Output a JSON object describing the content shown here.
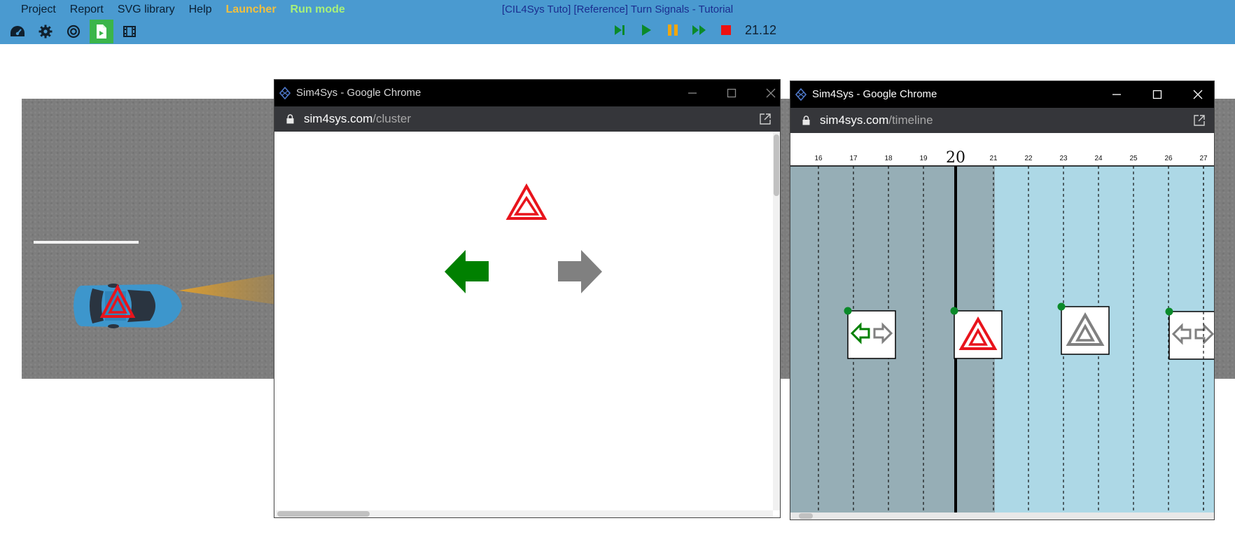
{
  "menu": {
    "items": [
      "Project",
      "Report",
      "SVG library",
      "Help"
    ],
    "launcher": "Launcher",
    "run_mode": "Run mode"
  },
  "app_title": "[CIL4Sys Tuto] [Reference] Turn Signals - Tutorial",
  "toolbar": {
    "icons": [
      "dashboard-icon",
      "gear-icon",
      "target-icon",
      "document-icon",
      "film-icon"
    ],
    "active_icon": "document-icon"
  },
  "player": {
    "icons": [
      "step-icon",
      "play-icon",
      "pause-icon",
      "fast-forward-icon",
      "stop-icon"
    ],
    "time": "21.12"
  },
  "colors": {
    "appbar": "#4a9ad0",
    "green": "#008000",
    "gray_arrow": "#808080",
    "hazard_red": "#e8141c",
    "car_blue": "#3d96cc",
    "past_region": "#96aeb6",
    "future_region": "#add8e6"
  },
  "cluster_window": {
    "title": "Sim4Sys - Google Chrome",
    "url_host": "sim4sys.com",
    "url_path": "/cluster",
    "left_arrow_state": "on",
    "right_arrow_state": "off",
    "hazard_state": "on"
  },
  "timeline_window": {
    "title": "Sim4Sys - Google Chrome",
    "url_host": "sim4sys.com",
    "url_path": "/timeline",
    "ticks": [
      "16",
      "17",
      "18",
      "19",
      "20",
      "21",
      "22",
      "23",
      "24",
      "25",
      "26",
      "27"
    ],
    "current_tick": "20",
    "events": [
      {
        "name": "turn-signal-left-event",
        "icon": "left-right-arrow-icon"
      },
      {
        "name": "hazard-on-event",
        "icon": "hazard-icon"
      },
      {
        "name": "hazard-off-event",
        "icon": "hazard-gray-icon"
      },
      {
        "name": "turn-signal-off-event",
        "icon": "left-right-arrow-gray-icon"
      }
    ]
  }
}
